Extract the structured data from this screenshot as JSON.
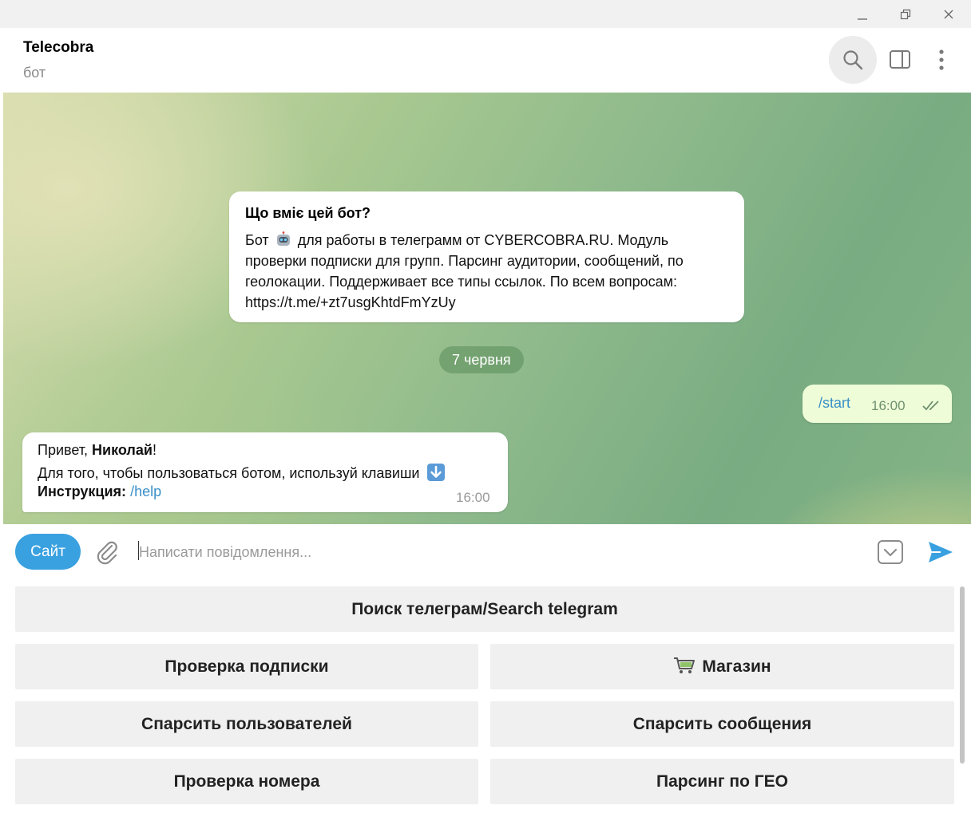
{
  "window": {
    "controls": [
      "minimize-icon",
      "restore-icon",
      "close-icon"
    ]
  },
  "header": {
    "title": "Telecobra",
    "subtitle": "бот",
    "icons": [
      "search-icon",
      "sidebar-toggle-icon",
      "more-vertical-icon"
    ]
  },
  "chat": {
    "info_card": {
      "title": "Що вміє цей бот?",
      "text_before_emoji": "Бот",
      "emoji": "robot-emoji",
      "text_after_emoji": "для работы в телеграмм от CYBERCOBRA.RU. Модуль проверки подписки для групп. Парсинг аудитории, сообщений, по геолокации. Поддерживает все типы ссылок. По всем вопросам: https://t.me/+zt7usgKhtdFmYzUy"
    },
    "date_separator": "7 червня",
    "outgoing": {
      "text": "/start",
      "time": "16:00",
      "status_icon": "double-check-icon"
    },
    "incoming": {
      "greeting": "Привет,",
      "name": "Николай",
      "exclamation": "!",
      "line2": "Для того, чтобы пользоваться ботом, используй клавиши",
      "line2_emoji": "down-arrow-emoji",
      "instruction_label": "Инструкция:",
      "instruction_link": "/help",
      "time": "16:00"
    },
    "colors": {
      "outgoing_bubble": "#eefdd8",
      "link": "#3a90c8",
      "accent": "#3aa1e0"
    }
  },
  "composer": {
    "site_button": "Сайт",
    "placeholder": "Написати повідомлення...",
    "value": "",
    "icons": [
      "attach-icon",
      "keyboard-toggle-icon",
      "send-icon"
    ]
  },
  "keyboard": {
    "buttons": [
      "Поиск телеграм/Search telegram",
      "Проверка подписки",
      "Магазин",
      "Спарсить пользователей",
      "Спарсить сообщения",
      "Проверка номера",
      "Парсинг по ГЕО"
    ],
    "shop_icon": "shopping-cart-emoji"
  }
}
